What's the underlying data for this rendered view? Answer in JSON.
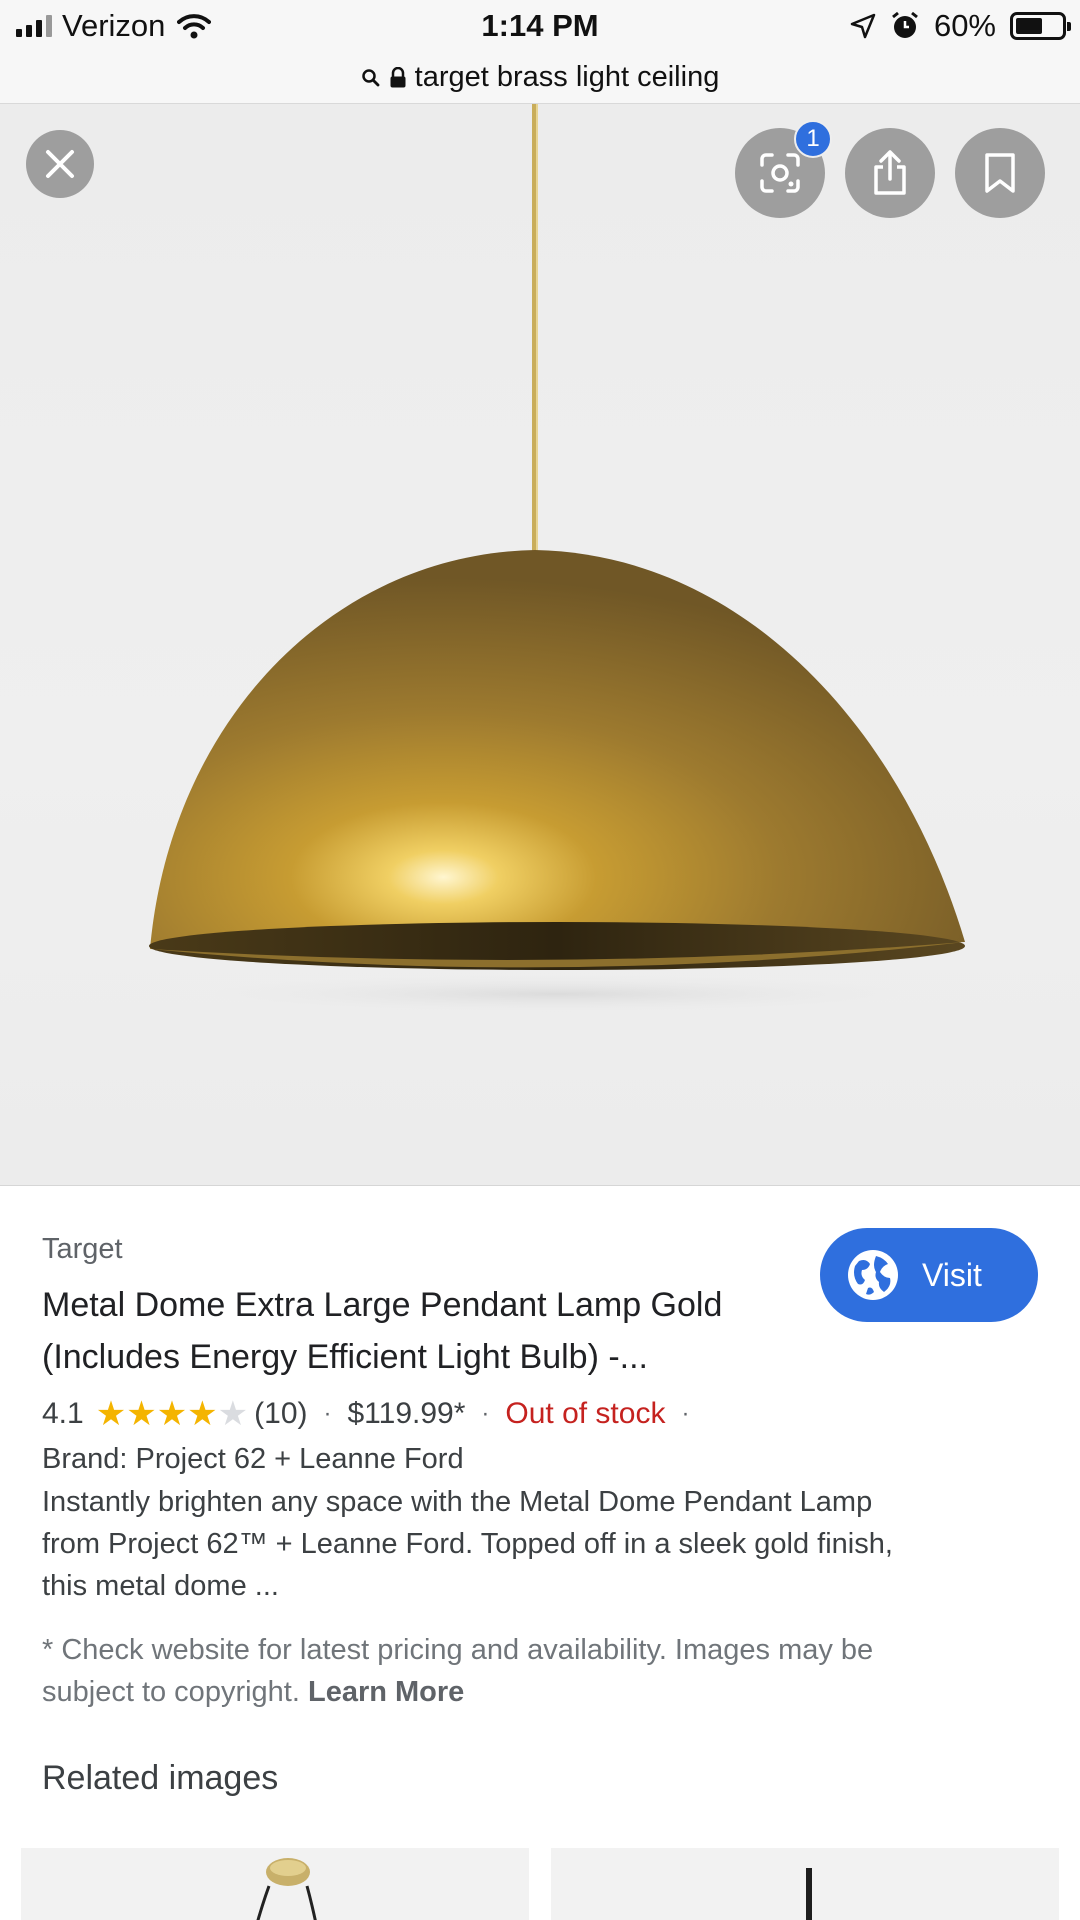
{
  "status_bar": {
    "carrier": "Verizon",
    "time": "1:14 PM",
    "battery_percent": "60%",
    "battery_level": 0.6
  },
  "address_bar": {
    "query": "target brass light ceiling"
  },
  "image_viewer": {
    "lens_badge_count": "1",
    "icons": [
      "close-icon",
      "lens-icon",
      "share-icon",
      "bookmark-icon"
    ]
  },
  "result": {
    "source": "Target",
    "title_line1": "Metal Dome Extra Large Pendant Lamp Gold",
    "title_line2": "(Includes Energy Efficient Light Bulb) -...",
    "visit_label": "Visit",
    "rating": "4.1",
    "rating_value": 4.1,
    "rating_max": 5,
    "review_count": "(10)",
    "price": "$119.99*",
    "stock_status": "Out of stock",
    "brand": "Brand: Project 62 + Leanne Ford",
    "description_line1": "Instantly brighten any space with the Metal Dome Pendant Lamp",
    "description_line2": "from Project 62™ + Leanne Ford. Topped off in a sleek gold finish,",
    "description_line3": "this metal dome ...",
    "disclaimer_line1": "* Check website for latest pricing and availability. Images may be",
    "disclaimer_line2": "subject to copyright.",
    "learn_more": "Learn More"
  },
  "related": {
    "heading": "Related images"
  },
  "colors": {
    "accent_blue": "#2f6fde",
    "out_of_stock_red": "#c5221f",
    "star_gold": "#f4b400",
    "star_empty": "#dadce0"
  }
}
